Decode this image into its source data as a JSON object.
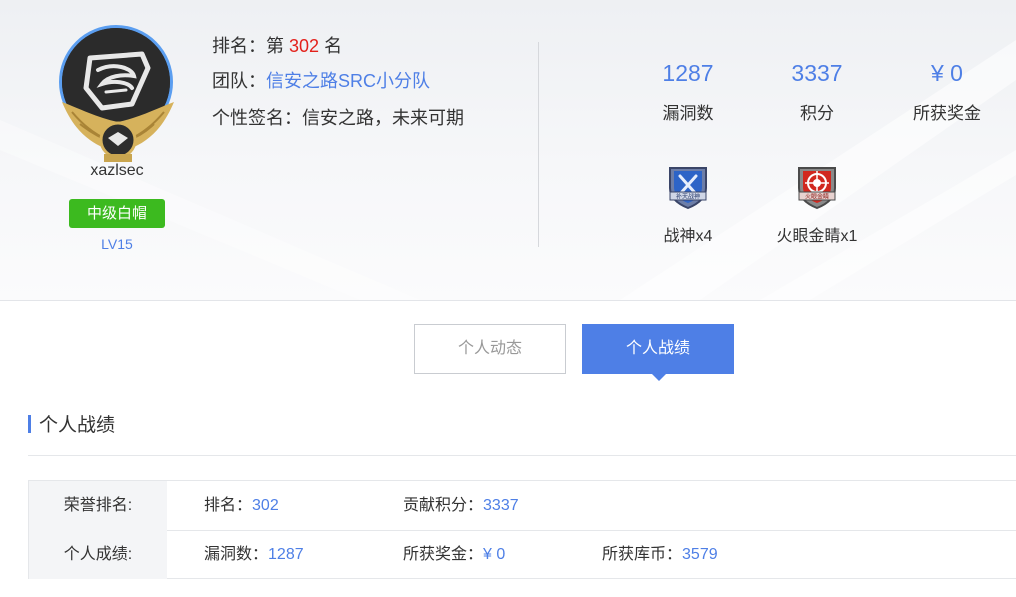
{
  "profile": {
    "username": "xazlsec",
    "level_title": "中级白帽",
    "level": "LV15",
    "rank_prefix": "排名：第 ",
    "rank": "302",
    "rank_suffix": " 名",
    "team_label": "团队：",
    "team": "信安之路SRC小分队",
    "signature_label": "个性签名：",
    "signature": "信安之路，未来可期"
  },
  "stats": [
    {
      "value": "1287",
      "label": "漏洞数"
    },
    {
      "value": "3337",
      "label": "积分"
    },
    {
      "value": "¥ 0",
      "label": "所获奖金"
    }
  ],
  "medals": [
    {
      "name": "战神x4",
      "icon": "war-god-medal-icon",
      "badge_text": "补天战神"
    },
    {
      "name": "火眼金睛x1",
      "icon": "fire-eye-medal-icon",
      "badge_text": "火眼金睛"
    }
  ],
  "tabs": [
    {
      "label": "个人动态",
      "active": false
    },
    {
      "label": "个人战绩",
      "active": true
    }
  ],
  "section_title": "个人战绩",
  "record_table": {
    "rows": [
      {
        "label": "荣誉排名:",
        "cells": [
          {
            "label": "排名：",
            "value": "302"
          },
          {
            "label": "贡献积分：",
            "value": "3337"
          }
        ]
      },
      {
        "label": "个人成绩:",
        "cells": [
          {
            "label": "漏洞数：",
            "value": "1287"
          },
          {
            "label": "所获奖金：",
            "value": "¥ 0"
          },
          {
            "label": "所获库币：",
            "value": "3579"
          }
        ]
      }
    ]
  },
  "colors": {
    "accent": "#4e7fe6",
    "rank_red": "#e3211b",
    "level_green": "#3cba1f"
  }
}
